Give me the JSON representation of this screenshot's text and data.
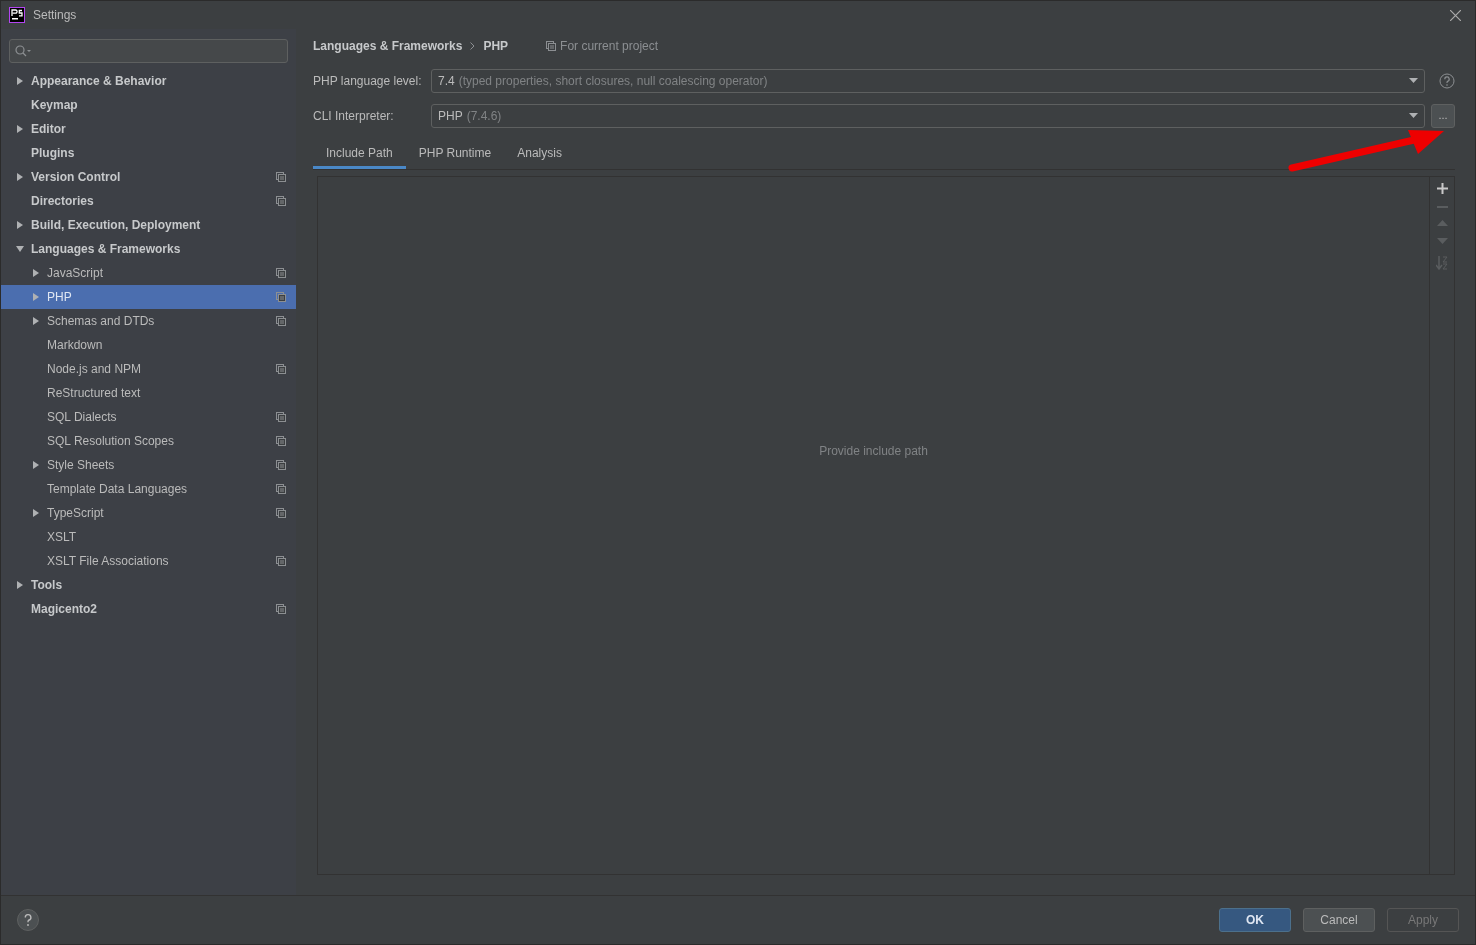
{
  "window": {
    "title": "Settings"
  },
  "sidebar": {
    "tree": [
      {
        "label": "Appearance & Behavior",
        "expanded": false,
        "project_level": false,
        "selected": false
      },
      {
        "label": "Keymap",
        "project_level": false,
        "selected": false
      },
      {
        "label": "Editor",
        "expanded": false,
        "project_level": false,
        "selected": false
      },
      {
        "label": "Plugins",
        "project_level": false,
        "selected": false
      },
      {
        "label": "Version Control",
        "expanded": false,
        "project_level": true,
        "selected": false
      },
      {
        "label": "Directories",
        "project_level": true,
        "selected": false
      },
      {
        "label": "Build, Execution, Deployment",
        "expanded": false,
        "project_level": false,
        "selected": false
      },
      {
        "label": "Languages & Frameworks",
        "expanded": true,
        "project_level": false,
        "selected": false,
        "children": [
          {
            "label": "JavaScript",
            "expanded": false,
            "project_level": true,
            "selected": false
          },
          {
            "label": "PHP",
            "expanded": false,
            "project_level": true,
            "selected": true
          },
          {
            "label": "Schemas and DTDs",
            "expanded": false,
            "project_level": true,
            "selected": false
          },
          {
            "label": "Markdown",
            "project_level": false,
            "selected": false
          },
          {
            "label": "Node.js and NPM",
            "project_level": true,
            "selected": false
          },
          {
            "label": "ReStructured text",
            "project_level": false,
            "selected": false
          },
          {
            "label": "SQL Dialects",
            "project_level": true,
            "selected": false
          },
          {
            "label": "SQL Resolution Scopes",
            "project_level": true,
            "selected": false
          },
          {
            "label": "Style Sheets",
            "expanded": false,
            "project_level": true,
            "selected": false
          },
          {
            "label": "Template Data Languages",
            "project_level": true,
            "selected": false
          },
          {
            "label": "TypeScript",
            "expanded": false,
            "project_level": true,
            "selected": false
          },
          {
            "label": "XSLT",
            "project_level": false,
            "selected": false
          },
          {
            "label": "XSLT File Associations",
            "project_level": true,
            "selected": false
          }
        ]
      },
      {
        "label": "Tools",
        "expanded": false,
        "project_level": false,
        "selected": false
      },
      {
        "label": "Magicento2",
        "project_level": true,
        "selected": false
      }
    ]
  },
  "breadcrumb": [
    "Languages & Frameworks",
    "PHP"
  ],
  "scope": "For current project",
  "fields": [
    {
      "label": "PHP language level:",
      "value": "7.4",
      "detail": "(typed properties, short closures, null coalescing operator)",
      "kind": "help"
    },
    {
      "label": "CLI Interpreter:",
      "value": "PHP",
      "detail": "(7.4.6)",
      "kind": "browse",
      "browse_label": "..."
    }
  ],
  "tabs": [
    {
      "label": "Include Path",
      "selected": true
    },
    {
      "label": "PHP Runtime",
      "selected": false
    },
    {
      "label": "Analysis",
      "selected": false
    }
  ],
  "include_path": {
    "empty_text": "Provide include path",
    "toolbar": [
      {
        "kind": "add",
        "disabled": false
      },
      {
        "kind": "remove",
        "disabled": true
      },
      {
        "kind": "up",
        "disabled": true
      },
      {
        "kind": "down",
        "disabled": true
      },
      {
        "kind": "sort",
        "disabled": true
      }
    ]
  },
  "buttons": [
    {
      "label": "OK",
      "primary": true,
      "disabled": false
    },
    {
      "label": "Cancel",
      "primary": false,
      "disabled": false
    },
    {
      "label": "Apply",
      "primary": false,
      "disabled": true
    }
  ]
}
